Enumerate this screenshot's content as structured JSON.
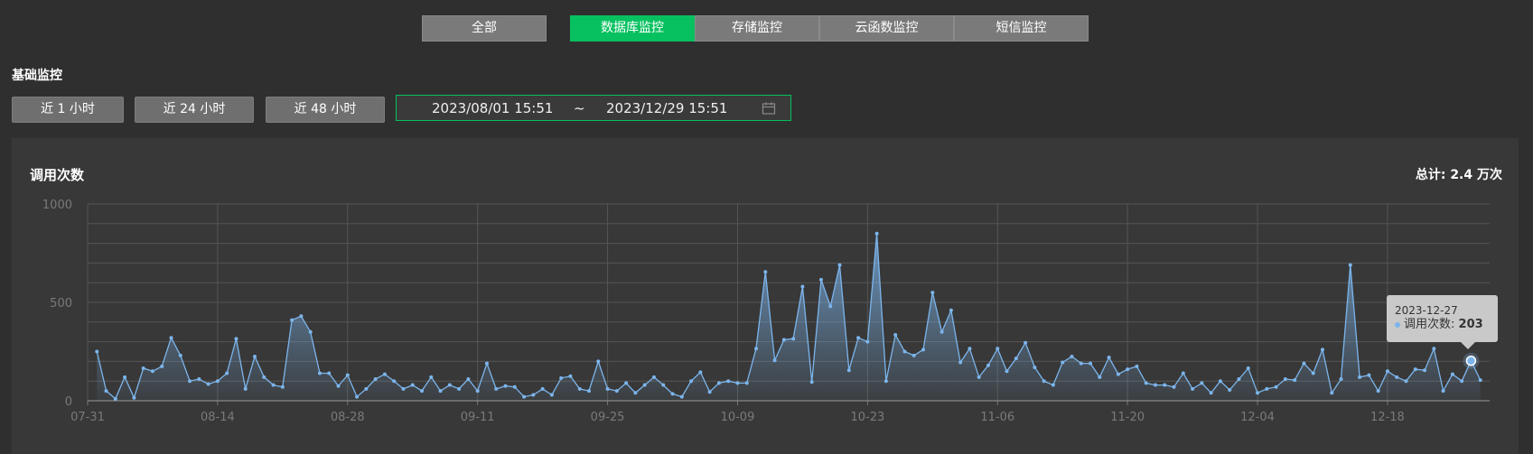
{
  "tabs": [
    {
      "label": "全部",
      "active": false
    },
    {
      "label": "数据库监控",
      "active": true
    },
    {
      "label": "存储监控",
      "active": false
    },
    {
      "label": "云函数监控",
      "active": false
    },
    {
      "label": "短信监控",
      "active": false
    }
  ],
  "section_title": "基础监控",
  "range_buttons": [
    "近 1 小时",
    "近 24 小时",
    "近 48 小时"
  ],
  "date_range": {
    "start": "2023/08/01 15:51",
    "separator": "~",
    "end": "2023/12/29 15:51"
  },
  "panel": {
    "title": "调用次数",
    "total": "总计: 2.4 万次"
  },
  "tooltip": {
    "date": "2023-12-27",
    "label": "调用次数:",
    "value": "203"
  },
  "colors": {
    "accent": "#07c160",
    "series": "#7cb5ec"
  },
  "chart_data": {
    "type": "area",
    "ylim": [
      0,
      1000
    ],
    "y_ticks": [
      0,
      500,
      1000
    ],
    "x_ticks": [
      "07-31",
      "08-14",
      "08-28",
      "09-11",
      "09-25",
      "10-09",
      "10-23",
      "11-06",
      "11-20",
      "12-04",
      "12-18"
    ],
    "x_start": "2023-07-31",
    "x_end": "2023-12-29",
    "grid": true,
    "series": [
      {
        "name": "调用次数",
        "x": [
          "2023-08-01",
          "2023-08-02",
          "2023-08-03",
          "2023-08-04",
          "2023-08-05",
          "2023-08-06",
          "2023-08-07",
          "2023-08-08",
          "2023-08-09",
          "2023-08-10",
          "2023-08-11",
          "2023-08-12",
          "2023-08-13",
          "2023-08-14",
          "2023-08-15",
          "2023-08-16",
          "2023-08-17",
          "2023-08-18",
          "2023-08-19",
          "2023-08-20",
          "2023-08-21",
          "2023-08-22",
          "2023-08-23",
          "2023-08-24",
          "2023-08-25",
          "2023-08-26",
          "2023-08-27",
          "2023-08-28",
          "2023-08-29",
          "2023-08-30",
          "2023-08-31",
          "2023-09-01",
          "2023-09-02",
          "2023-09-03",
          "2023-09-04",
          "2023-09-05",
          "2023-09-06",
          "2023-09-07",
          "2023-09-08",
          "2023-09-09",
          "2023-09-10",
          "2023-09-11",
          "2023-09-12",
          "2023-09-13",
          "2023-09-14",
          "2023-09-15",
          "2023-09-16",
          "2023-09-17",
          "2023-09-18",
          "2023-09-19",
          "2023-09-20",
          "2023-09-21",
          "2023-09-22",
          "2023-09-23",
          "2023-09-24",
          "2023-09-25",
          "2023-09-26",
          "2023-09-27",
          "2023-09-28",
          "2023-09-29",
          "2023-09-30",
          "2023-10-01",
          "2023-10-02",
          "2023-10-03",
          "2023-10-04",
          "2023-10-05",
          "2023-10-06",
          "2023-10-07",
          "2023-10-08",
          "2023-10-09",
          "2023-10-10",
          "2023-10-11",
          "2023-10-12",
          "2023-10-13",
          "2023-10-14",
          "2023-10-15",
          "2023-10-16",
          "2023-10-17",
          "2023-10-18",
          "2023-10-19",
          "2023-10-20",
          "2023-10-21",
          "2023-10-22",
          "2023-10-23",
          "2023-10-24",
          "2023-10-25",
          "2023-10-26",
          "2023-10-27",
          "2023-10-28",
          "2023-10-29",
          "2023-10-30",
          "2023-10-31",
          "2023-11-01",
          "2023-11-02",
          "2023-11-03",
          "2023-11-04",
          "2023-11-05",
          "2023-11-06",
          "2023-11-07",
          "2023-11-08",
          "2023-11-09",
          "2023-11-10",
          "2023-11-11",
          "2023-11-12",
          "2023-11-13",
          "2023-11-14",
          "2023-11-15",
          "2023-11-16",
          "2023-11-17",
          "2023-11-18",
          "2023-11-19",
          "2023-11-20",
          "2023-11-21",
          "2023-11-22",
          "2023-11-23",
          "2023-11-24",
          "2023-11-25",
          "2023-11-26",
          "2023-11-27",
          "2023-11-28",
          "2023-11-29",
          "2023-11-30",
          "2023-12-01",
          "2023-12-02",
          "2023-12-03",
          "2023-12-04",
          "2023-12-05",
          "2023-12-06",
          "2023-12-07",
          "2023-12-08",
          "2023-12-09",
          "2023-12-10",
          "2023-12-11",
          "2023-12-12",
          "2023-12-13",
          "2023-12-14",
          "2023-12-15",
          "2023-12-16",
          "2023-12-17",
          "2023-12-18",
          "2023-12-19",
          "2023-12-20",
          "2023-12-21",
          "2023-12-22",
          "2023-12-23",
          "2023-12-24",
          "2023-12-25",
          "2023-12-26",
          "2023-12-27",
          "2023-12-28"
        ],
        "values": [
          250,
          50,
          10,
          120,
          15,
          165,
          150,
          175,
          320,
          230,
          100,
          110,
          85,
          100,
          140,
          315,
          60,
          225,
          120,
          80,
          70,
          410,
          430,
          350,
          140,
          140,
          75,
          130,
          20,
          60,
          110,
          135,
          100,
          60,
          80,
          50,
          120,
          50,
          80,
          60,
          110,
          50,
          190,
          60,
          75,
          70,
          20,
          30,
          60,
          30,
          115,
          125,
          60,
          50,
          200,
          60,
          50,
          90,
          40,
          80,
          120,
          80,
          35,
          20,
          100,
          145,
          45,
          90,
          100,
          90,
          90,
          265,
          655,
          205,
          310,
          315,
          580,
          95,
          615,
          480,
          690,
          155,
          320,
          300,
          850,
          100,
          335,
          250,
          230,
          260,
          550,
          350,
          460,
          195,
          265,
          120,
          180,
          265,
          150,
          215,
          295,
          170,
          100,
          80,
          195,
          225,
          190,
          190,
          120,
          220,
          135,
          160,
          175,
          90,
          80,
          80,
          70,
          140,
          60,
          90,
          40,
          100,
          55,
          110,
          165,
          40,
          60,
          70,
          110,
          105,
          190,
          140,
          260,
          40,
          110,
          690,
          120,
          130,
          50,
          150,
          120,
          100,
          160,
          155,
          265,
          50,
          135,
          100,
          203,
          105
        ]
      }
    ]
  }
}
